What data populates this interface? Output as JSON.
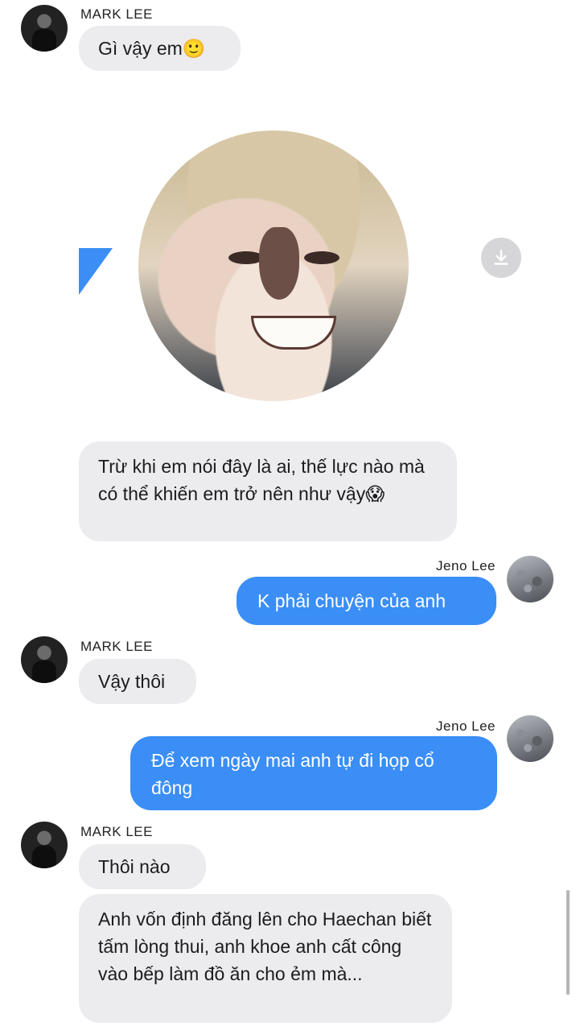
{
  "participants": {
    "mark": "MARK LEE",
    "jeno": "Jeno Lee"
  },
  "messages": [
    {
      "sender": "MARK LEE",
      "text": "Gì vậy em",
      "emoji": "🙂"
    },
    {
      "sender": "MARK LEE",
      "type": "image"
    },
    {
      "sender": "MARK LEE",
      "text": "Trừ khi em nói đây là ai, thế lực nào mà có thể khiến em trở nên như vậy",
      "emoji": "😱"
    },
    {
      "sender": "Jeno Lee",
      "text": "K phải chuyện của anh"
    },
    {
      "sender": "MARK LEE",
      "text": "Vậy thôi"
    },
    {
      "sender": "Jeno Lee",
      "text": "Để xem ngày mai anh tự đi họp cổ đông"
    },
    {
      "sender": "MARK LEE",
      "text": "Thôi nào"
    },
    {
      "sender": "MARK LEE",
      "text": "Anh vốn định đăng lên cho Haechan biết tấm lòng thui, anh khoe anh cất công vào bếp làm đồ ăn cho ẻm mà..."
    }
  ],
  "colors": {
    "outgoing_bubble": "#3a8ef6",
    "incoming_bubble": "#ececef"
  },
  "icons": {
    "download": "download-icon"
  }
}
